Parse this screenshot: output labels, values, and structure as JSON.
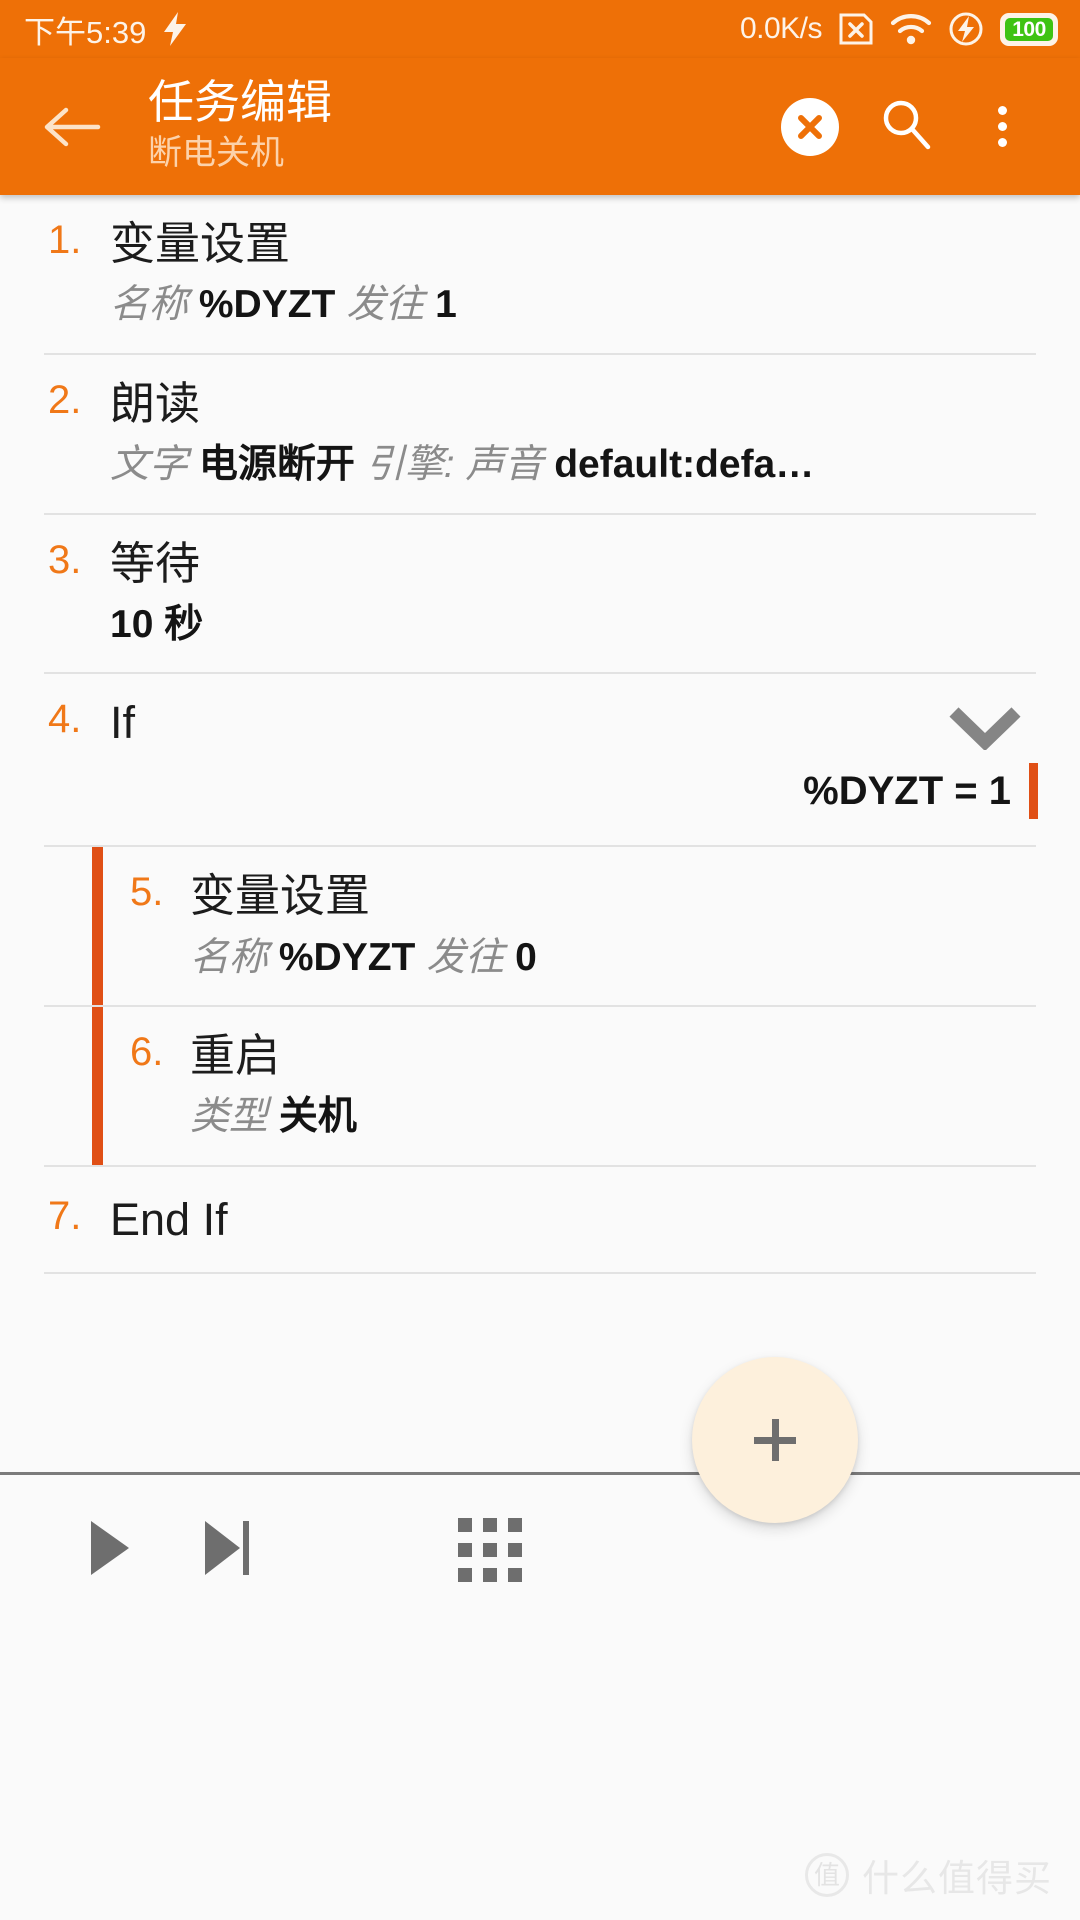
{
  "theme": {
    "accent_orange": "#ee7007",
    "number_orange": "#f07818",
    "indent_bar_red": "#e04f15",
    "page_bg": "#fafafa",
    "fab_bg": "#fdf0dc",
    "battery_green": "#3ec313"
  },
  "statusbar": {
    "time": "下午5:39",
    "charging_icon": "lightning-bolt-icon",
    "net_speed": "0.0K/s",
    "sim_icon": "sim-card-x-icon",
    "wifi_icon": "wifi-icon",
    "flash_icon": "flash-circle-icon",
    "battery_level": "100"
  },
  "appbar": {
    "back_icon": "back-arrow-icon",
    "title": "任务编辑",
    "subtitle": "断电关机",
    "close_icon": "close-circle-icon",
    "search_icon": "search-icon",
    "overflow_icon": "overflow-menu-icon"
  },
  "actions": [
    {
      "num": "1.",
      "title": "变量设置",
      "indented": false,
      "parts": [
        {
          "type": "label",
          "text": "名称"
        },
        {
          "type": "value",
          "text": "%DYZT"
        },
        {
          "type": "label",
          "text": "发往"
        },
        {
          "type": "value",
          "text": "1"
        }
      ]
    },
    {
      "num": "2.",
      "title": "朗读",
      "indented": false,
      "parts": [
        {
          "type": "label",
          "text": "文字"
        },
        {
          "type": "value",
          "text": "电源断开"
        },
        {
          "type": "label",
          "text": "引擎: 声音"
        },
        {
          "type": "value",
          "text": "default:defa…"
        }
      ]
    },
    {
      "num": "3.",
      "title": "等待",
      "indented": false,
      "parts": [
        {
          "type": "value",
          "text": "10 秒"
        }
      ]
    },
    {
      "num": "4.",
      "title": "If",
      "indented": false,
      "collapse_icon": "chevron-down-icon",
      "condition": "%DYZT = 1",
      "parts": []
    },
    {
      "num": "5.",
      "title": "变量设置",
      "indented": true,
      "parts": [
        {
          "type": "label",
          "text": "名称"
        },
        {
          "type": "value",
          "text": "%DYZT"
        },
        {
          "type": "label",
          "text": "发往"
        },
        {
          "type": "value",
          "text": "0"
        }
      ]
    },
    {
      "num": "6.",
      "title": "重启",
      "indented": true,
      "parts": [
        {
          "type": "label",
          "text": "类型"
        },
        {
          "type": "value",
          "text": "关机"
        }
      ]
    },
    {
      "num": "7.",
      "title": "End If",
      "indented": false,
      "parts": []
    }
  ],
  "bottombar": {
    "play_icon": "play-icon",
    "step_icon": "step-forward-icon",
    "grid_icon": "grid-menu-icon"
  },
  "fab": {
    "icon": "plus-icon",
    "label": "+"
  },
  "watermark": {
    "logo": "值",
    "text": "什么值得买"
  }
}
